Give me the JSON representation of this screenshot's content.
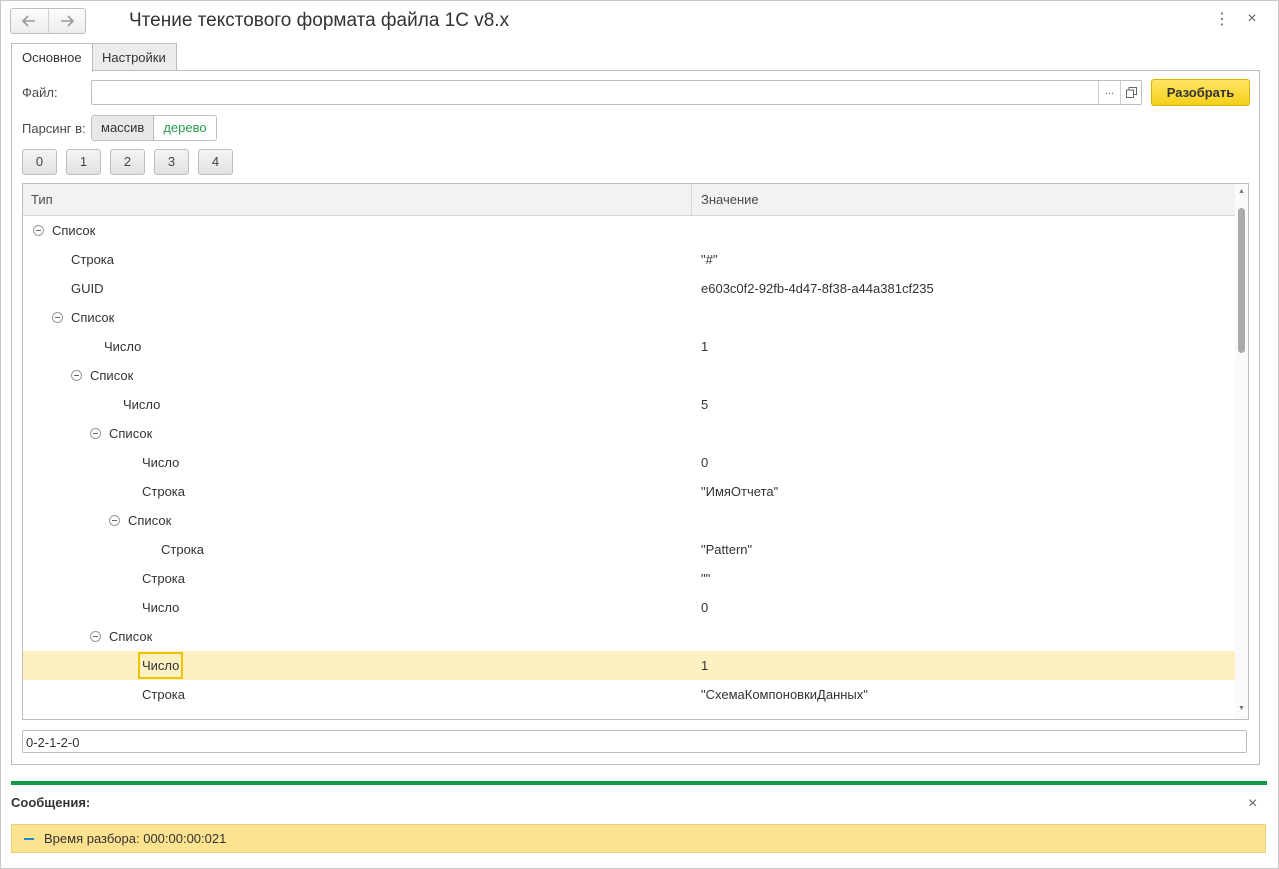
{
  "window": {
    "title": "Чтение текстового формата файла 1С v8.x",
    "menu_icon": "⋮",
    "close_icon": "×"
  },
  "tabs": [
    {
      "label": "Основное",
      "active": true
    },
    {
      "label": "Настройки",
      "active": false
    }
  ],
  "form": {
    "file_label": "Файл:",
    "file_value": "",
    "browse_label": "...",
    "open_icon": "open-window-icon",
    "parse_button": "Разобрать",
    "parsing_label": "Парсинг в:",
    "parsing_options": [
      "массив",
      "дерево"
    ],
    "parsing_selected": "массив",
    "level_buttons": [
      "0",
      "1",
      "2",
      "3",
      "4"
    ]
  },
  "grid": {
    "columns": [
      "Тип",
      "Значение"
    ],
    "rows": [
      {
        "level": 0,
        "type": "Список",
        "value": "",
        "expandable": true
      },
      {
        "level": 1,
        "type": "Строка",
        "value": "\"#\""
      },
      {
        "level": 1,
        "type": "GUID",
        "value": "e603c0f2-92fb-4d47-8f38-a44a381cf235"
      },
      {
        "level": 1,
        "type": "Список",
        "value": "",
        "expandable": true
      },
      {
        "level": 2,
        "type": "Число",
        "value": "1"
      },
      {
        "level": 2,
        "type": "Список",
        "value": "",
        "expandable": true
      },
      {
        "level": 3,
        "type": "Число",
        "value": "5"
      },
      {
        "level": 3,
        "type": "Список",
        "value": "",
        "expandable": true
      },
      {
        "level": 4,
        "type": "Число",
        "value": "0"
      },
      {
        "level": 4,
        "type": "Строка",
        "value": "\"ИмяОтчета\""
      },
      {
        "level": 4,
        "type": "Список",
        "value": "",
        "expandable": true
      },
      {
        "level": 5,
        "type": "Строка",
        "value": "\"Pattern\""
      },
      {
        "level": 4,
        "type": "Строка",
        "value": "\"\""
      },
      {
        "level": 4,
        "type": "Число",
        "value": "0"
      },
      {
        "level": 3,
        "type": "Список",
        "value": "",
        "expandable": true
      },
      {
        "level": 4,
        "type": "Число",
        "value": "1",
        "selected": true
      },
      {
        "level": 4,
        "type": "Строка",
        "value": "\"СхемаКомпоновкиДанных\""
      }
    ]
  },
  "path_value": "0-2-1-2-0",
  "messages": {
    "header": "Сообщения:",
    "close_icon": "×",
    "items": [
      {
        "text": "Время разбора: 000:00:00:021"
      }
    ]
  },
  "colors": {
    "accent_green": "#119a48",
    "button_yellow": "#f5cf1a",
    "selection_row": "#fdf0c3",
    "message_bg": "#fde28f"
  }
}
